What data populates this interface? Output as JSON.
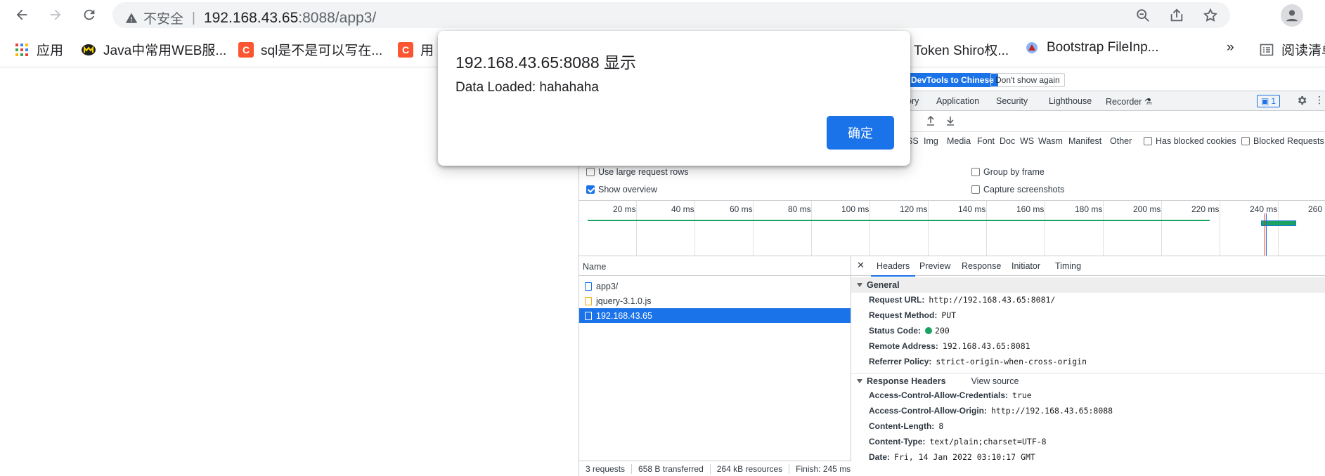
{
  "browser": {
    "security_label": "不安全",
    "url_host": "192.168.43.65",
    "url_rest": ":8088/app3/",
    "bookmarks": [
      {
        "label": "应用",
        "icon": "apps-grid-icon"
      },
      {
        "label": "Java中常用WEB服...",
        "icon": "m-logo-icon"
      },
      {
        "label": "sql是不是可以写在...",
        "icon": "csdn-icon"
      },
      {
        "label": "用",
        "icon": "csdn-icon"
      },
      {
        "label": "Token Shiro权...",
        "icon": ""
      },
      {
        "label": "Bootstrap FileInp...",
        "icon": "site-icon"
      },
      {
        "label": "»",
        "icon": ""
      },
      {
        "label": "阅读清单",
        "icon": "reading-list-icon"
      }
    ],
    "csdn_letter": "C"
  },
  "dialog": {
    "title": "192.168.43.65:8088 显示",
    "message": "Data Loaded: hahahaha",
    "ok_label": "确定"
  },
  "devtools": {
    "lang_button": "DevTools to Chinese",
    "dont_show": "Don't show again",
    "tabs": [
      "ory",
      "Application",
      "Security",
      "Lighthouse",
      "Recorder"
    ],
    "issues_count": "1",
    "filters": [
      "SS",
      "Img",
      "Media",
      "Font",
      "Doc",
      "WS",
      "Wasm",
      "Manifest",
      "Other"
    ],
    "has_blocked_cookies": "Has blocked cookies",
    "blocked_requests": "Blocked Requests",
    "options": {
      "large_rows": "Use large request rows",
      "show_overview": "Show overview",
      "group_by_frame": "Group by frame",
      "capture_screenshots": "Capture screenshots"
    },
    "ticks": [
      "20 ms",
      "40 ms",
      "60 ms",
      "80 ms",
      "100 ms",
      "120 ms",
      "140 ms",
      "160 ms",
      "180 ms",
      "200 ms",
      "220 ms",
      "240 ms",
      "260 ms"
    ],
    "name_header": "Name",
    "requests": [
      "app3/",
      "jquery-3.1.0.js",
      "192.168.43.65"
    ],
    "detail_tabs": [
      "Headers",
      "Preview",
      "Response",
      "Initiator",
      "Timing"
    ],
    "general_title": "General",
    "general": [
      {
        "k": "Request URL:",
        "v": "http://192.168.43.65:8081/"
      },
      {
        "k": "Request Method:",
        "v": "PUT"
      },
      {
        "k": "Status Code:",
        "v": "200"
      },
      {
        "k": "Remote Address:",
        "v": "192.168.43.65:8081"
      },
      {
        "k": "Referrer Policy:",
        "v": "strict-origin-when-cross-origin"
      }
    ],
    "response_title": "Response Headers",
    "view_source": "View source",
    "response": [
      {
        "k": "Access-Control-Allow-Credentials:",
        "v": "true"
      },
      {
        "k": "Access-Control-Allow-Origin:",
        "v": "http://192.168.43.65:8088"
      },
      {
        "k": "Content-Length:",
        "v": "8"
      },
      {
        "k": "Content-Type:",
        "v": "text/plain;charset=UTF-8"
      },
      {
        "k": "Date:",
        "v": "Fri, 14 Jan 2022 03:10:17 GMT"
      }
    ],
    "status": [
      "3 requests",
      "658 B transferred",
      "264 kB resources",
      "Finish: 245 ms"
    ]
  }
}
